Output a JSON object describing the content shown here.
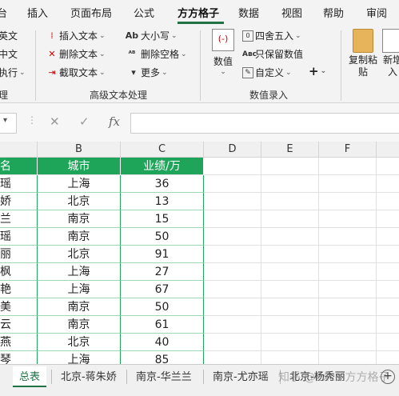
{
  "ribbon_tabs": [
    {
      "label": "台"
    },
    {
      "label": "插入"
    },
    {
      "label": "页面布局"
    },
    {
      "label": "公式"
    },
    {
      "label": "方方格子",
      "active": true
    },
    {
      "label": "数据"
    },
    {
      "label": "视图"
    },
    {
      "label": "帮助"
    },
    {
      "label": "审阅"
    }
  ],
  "ribbon": {
    "left_partial": [
      "英文",
      "中文",
      "执行"
    ],
    "left_group_label": "理",
    "text_group": {
      "insert_text": "插入文本",
      "delete_text": "删除文本",
      "extract_text": "截取文本",
      "case": "大小写",
      "delete_spaces": "删除空格",
      "more": "更多",
      "label": "高级文本处理"
    },
    "number_group": {
      "value_button": "数值",
      "round": "四舍五入",
      "keep_value": "只保留数值",
      "custom": "自定义",
      "plus": "+",
      "label": "数值录入"
    },
    "copy_paste": "复制粘\n贴",
    "new_add": "新增\n入",
    "accent_color": "#217346"
  },
  "formula_bar": {
    "cancel": "✕",
    "confirm": "✓",
    "fx": "fx",
    "value": ""
  },
  "columns": [
    "",
    "B",
    "C",
    "D",
    "E",
    "F"
  ],
  "header_row": [
    "名",
    "城市",
    "业绩/万"
  ],
  "rows": [
    [
      "瑶",
      "上海",
      "36"
    ],
    [
      "娇",
      "北京",
      "13"
    ],
    [
      "兰",
      "南京",
      "15"
    ],
    [
      "瑶",
      "南京",
      "50"
    ],
    [
      "丽",
      "北京",
      "91"
    ],
    [
      "枫",
      "上海",
      "27"
    ],
    [
      "艳",
      "上海",
      "67"
    ],
    [
      "美",
      "南京",
      "50"
    ],
    [
      "云",
      "南京",
      "61"
    ],
    [
      "燕",
      "北京",
      "40"
    ],
    [
      "琴",
      "上海",
      "85"
    ]
  ],
  "sheet_tabs": [
    {
      "label": "总表",
      "active": true
    },
    {
      "label": "北京-蒋朱娇"
    },
    {
      "label": "南京-华兰兰"
    },
    {
      "label": "南京-尤亦瑶"
    },
    {
      "label": "北京-杨秀丽"
    }
  ],
  "watermark": "知乎 @Excel方方格子",
  "header_fill": "#1fa55a"
}
